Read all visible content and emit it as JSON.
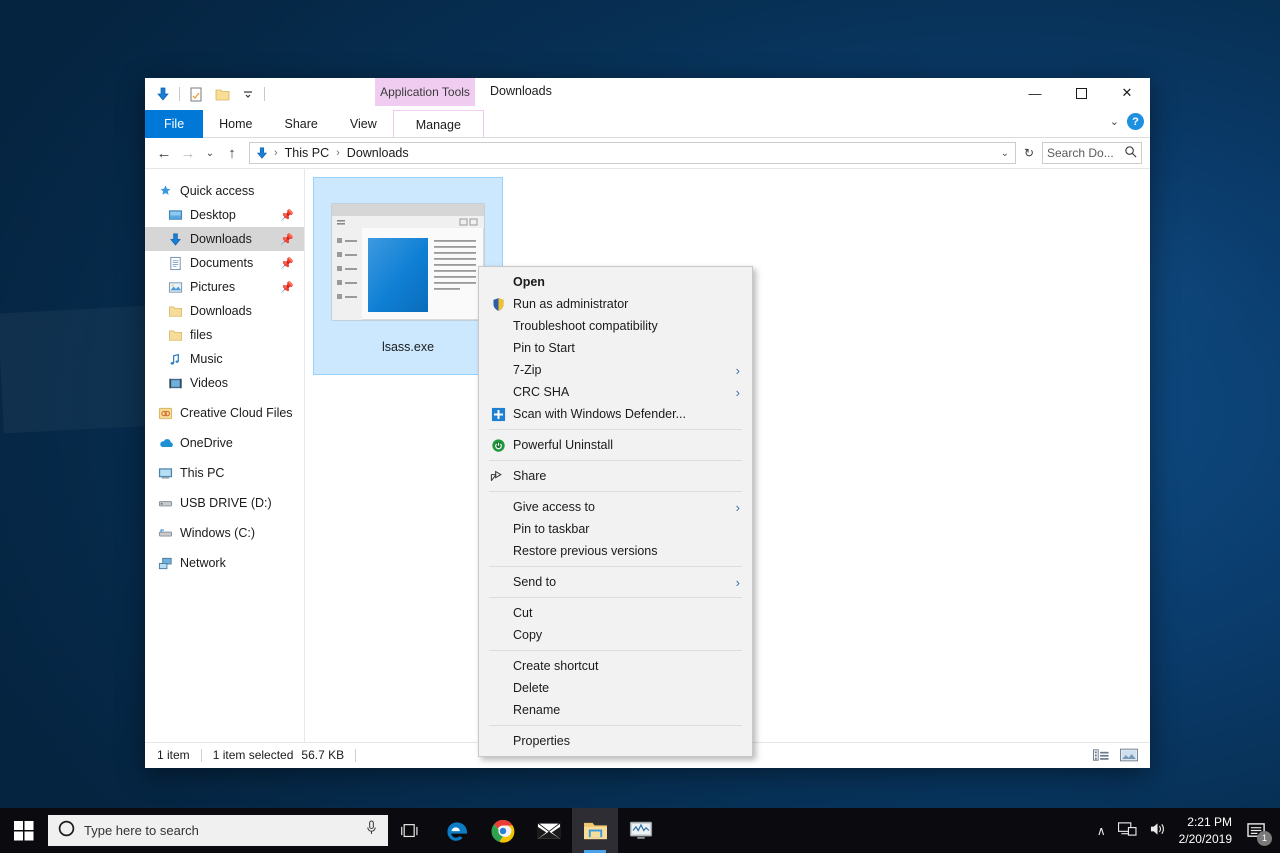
{
  "window": {
    "title": "Downloads",
    "contextual_tab": "Application Tools",
    "quick_access_icons": [
      "downloads-arrow-icon",
      "properties-icon",
      "new-folder-icon",
      "customize-dropdown-icon"
    ],
    "controls": {
      "minimize": "—",
      "maximize": "☐",
      "close": "✕"
    },
    "help_label": "?",
    "collapse_ribbon": "⌄"
  },
  "ribbon": {
    "tabs": [
      {
        "label": "File",
        "state": "file"
      },
      {
        "label": "Home",
        "state": "normal"
      },
      {
        "label": "Share",
        "state": "normal"
      },
      {
        "label": "View",
        "state": "normal"
      },
      {
        "label": "Manage",
        "state": "contextual"
      }
    ]
  },
  "address": {
    "back": "←",
    "forward": "→",
    "recent": "⌄",
    "up": "↑",
    "crumbs": [
      "This PC",
      "Downloads"
    ],
    "separator": "›",
    "dropdown": "⌄",
    "refresh": "↻",
    "search_placeholder": "Search Do..."
  },
  "sidebar": {
    "items": [
      {
        "label": "Quick access",
        "icon": "star-pin-icon",
        "indent": 0,
        "selected": false,
        "pinned": false
      },
      {
        "label": "Desktop",
        "icon": "desktop-icon",
        "indent": 1,
        "selected": false,
        "pinned": true
      },
      {
        "label": "Downloads",
        "icon": "downloads-arrow-icon",
        "indent": 1,
        "selected": true,
        "pinned": true
      },
      {
        "label": "Documents",
        "icon": "documents-icon",
        "indent": 1,
        "selected": false,
        "pinned": true
      },
      {
        "label": "Pictures",
        "icon": "pictures-icon",
        "indent": 1,
        "selected": false,
        "pinned": true
      },
      {
        "label": "Downloads",
        "icon": "folder-icon",
        "indent": 1,
        "selected": false,
        "pinned": false
      },
      {
        "label": "files",
        "icon": "folder-icon",
        "indent": 1,
        "selected": false,
        "pinned": false
      },
      {
        "label": "Music",
        "icon": "music-note-icon",
        "indent": 1,
        "selected": false,
        "pinned": false
      },
      {
        "label": "Videos",
        "icon": "video-icon",
        "indent": 1,
        "selected": false,
        "pinned": false
      },
      {
        "label": "Creative Cloud Files",
        "icon": "creative-cloud-icon",
        "indent": 0,
        "selected": false,
        "pinned": false
      },
      {
        "label": "OneDrive",
        "icon": "onedrive-cloud-icon",
        "indent": 0,
        "selected": false,
        "pinned": false
      },
      {
        "label": "This PC",
        "icon": "this-pc-icon",
        "indent": 0,
        "selected": false,
        "pinned": false
      },
      {
        "label": "USB DRIVE (D:)",
        "icon": "usb-drive-icon",
        "indent": 0,
        "selected": false,
        "pinned": false
      },
      {
        "label": "Windows (C:)",
        "icon": "hard-drive-icon",
        "indent": 0,
        "selected": false,
        "pinned": false
      },
      {
        "label": "Network",
        "icon": "network-icon",
        "indent": 0,
        "selected": false,
        "pinned": false
      }
    ]
  },
  "files": [
    {
      "name": "lsass.exe",
      "icon": "application-exe-icon",
      "selected": true
    }
  ],
  "context_menu": {
    "items": [
      {
        "label": "Open",
        "icon": null,
        "bold": true,
        "submenu": false
      },
      {
        "label": "Run as administrator",
        "icon": "shield-icon",
        "bold": false,
        "submenu": false
      },
      {
        "label": "Troubleshoot compatibility",
        "icon": null,
        "bold": false,
        "submenu": false
      },
      {
        "label": "Pin to Start",
        "icon": null,
        "bold": false,
        "submenu": false
      },
      {
        "label": "7-Zip",
        "icon": null,
        "bold": false,
        "submenu": true
      },
      {
        "label": "CRC SHA",
        "icon": null,
        "bold": false,
        "submenu": true
      },
      {
        "label": "Scan with Windows Defender...",
        "icon": "defender-icon",
        "bold": false,
        "submenu": false
      },
      {
        "separator": true
      },
      {
        "label": "Powerful Uninstall",
        "icon": "uninstall-icon",
        "bold": false,
        "submenu": false
      },
      {
        "separator": true
      },
      {
        "label": "Share",
        "icon": "share-icon",
        "bold": false,
        "submenu": false
      },
      {
        "separator": true
      },
      {
        "label": "Give access to",
        "icon": null,
        "bold": false,
        "submenu": true
      },
      {
        "label": "Pin to taskbar",
        "icon": null,
        "bold": false,
        "submenu": false
      },
      {
        "label": "Restore previous versions",
        "icon": null,
        "bold": false,
        "submenu": false
      },
      {
        "separator": true
      },
      {
        "label": "Send to",
        "icon": null,
        "bold": false,
        "submenu": true
      },
      {
        "separator": true
      },
      {
        "label": "Cut",
        "icon": null,
        "bold": false,
        "submenu": false
      },
      {
        "label": "Copy",
        "icon": null,
        "bold": false,
        "submenu": false
      },
      {
        "separator": true
      },
      {
        "label": "Create shortcut",
        "icon": null,
        "bold": false,
        "submenu": false
      },
      {
        "label": "Delete",
        "icon": null,
        "bold": false,
        "submenu": false
      },
      {
        "label": "Rename",
        "icon": null,
        "bold": false,
        "submenu": false
      },
      {
        "separator": true
      },
      {
        "label": "Properties",
        "icon": null,
        "bold": false,
        "submenu": false
      }
    ],
    "submenu_arrow": "›"
  },
  "statusbar": {
    "item_count": "1 item",
    "selection": "1 item selected",
    "size": "56.7 KB",
    "view_details_icon": "details-view-icon",
    "view_large_icon": "large-icons-view-icon"
  },
  "taskbar": {
    "start_icon": "windows-start-icon",
    "search_placeholder": "Type here to search",
    "search_circle_icon": "cortana-circle-icon",
    "mic_icon": "microphone-icon",
    "buttons": [
      {
        "name": "task-view",
        "icon": "task-view-icon",
        "active": false,
        "open": false
      },
      {
        "name": "edge",
        "icon": "edge-icon",
        "active": false,
        "open": false
      },
      {
        "name": "chrome",
        "icon": "chrome-icon",
        "active": false,
        "open": false
      },
      {
        "name": "mail",
        "icon": "mail-icon",
        "active": false,
        "open": false
      },
      {
        "name": "file-explorer",
        "icon": "file-explorer-icon",
        "active": true,
        "open": true
      },
      {
        "name": "system-monitor",
        "icon": "monitor-app-icon",
        "active": false,
        "open": false
      }
    ],
    "tray": {
      "chevron": "∧",
      "network_icon": "network-tray-icon",
      "volume_icon": "speaker-icon",
      "time": "2:21 PM",
      "date": "2/20/2019",
      "notification_icon": "action-center-icon",
      "notification_count": "1"
    }
  },
  "colors": {
    "accent": "#0078d7",
    "contextual_tab": "#f0ccf0",
    "selection": "#cce8ff",
    "selection_border": "#99d1ff",
    "nav_selected": "#d6d6d6",
    "menu_bg": "#f2f2f2",
    "taskbar_bg": "#0b0b0f"
  }
}
